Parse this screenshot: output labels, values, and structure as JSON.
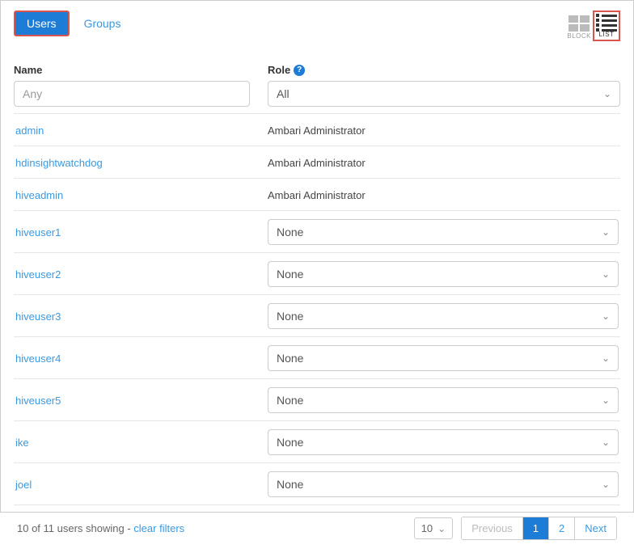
{
  "tabs": {
    "users": "Users",
    "groups": "Groups"
  },
  "viewToggles": {
    "block": "BLOCK",
    "list": "LIST"
  },
  "filters": {
    "nameLabel": "Name",
    "namePlaceholder": "Any",
    "roleLabel": "Role",
    "roleValue": "All"
  },
  "rows": [
    {
      "name": "admin",
      "role": "Ambari Administrator",
      "editable": false
    },
    {
      "name": "hdinsightwatchdog",
      "role": "Ambari Administrator",
      "editable": false
    },
    {
      "name": "hiveadmin",
      "role": "Ambari Administrator",
      "editable": false
    },
    {
      "name": "hiveuser1",
      "role": "None",
      "editable": true
    },
    {
      "name": "hiveuser2",
      "role": "None",
      "editable": true
    },
    {
      "name": "hiveuser3",
      "role": "None",
      "editable": true
    },
    {
      "name": "hiveuser4",
      "role": "None",
      "editable": true
    },
    {
      "name": "hiveuser5",
      "role": "None",
      "editable": true
    },
    {
      "name": "ike",
      "role": "None",
      "editable": true
    },
    {
      "name": "joel",
      "role": "None",
      "editable": true
    }
  ],
  "footer": {
    "showingPrefix": "10 of 11 users showing - ",
    "clearFilters": "clear filters",
    "pageSize": "10",
    "previous": "Previous",
    "pages": [
      "1",
      "2"
    ],
    "next": "Next"
  }
}
